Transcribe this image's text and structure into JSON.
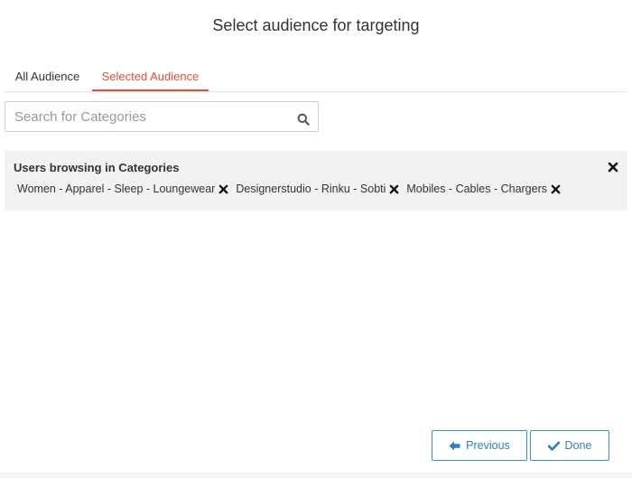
{
  "dialog": {
    "title": "Select audience for targeting"
  },
  "tabs": [
    {
      "label": "All Audience",
      "active": false
    },
    {
      "label": "Selected Audience",
      "active": true
    }
  ],
  "search": {
    "value": "",
    "placeholder": "Search for Categories",
    "icon": "search-icon"
  },
  "panel": {
    "title": "Users browsing in Categories",
    "close_icon": "close-icon",
    "chips": [
      {
        "label": "Women - Apparel - Sleep - Loungewear"
      },
      {
        "label": "Designerstudio - Rinku - Sobti"
      },
      {
        "label": "Mobiles - Cables - Chargers"
      }
    ]
  },
  "buttons": {
    "previous_label": "Previous",
    "previous_icon": "arrow-left-icon",
    "done_label": "Done",
    "done_icon": "check-icon"
  },
  "colors": {
    "accent": "#e0503a",
    "button_blue": "#2f7fc6",
    "panel_bg": "#f2f2f2"
  }
}
